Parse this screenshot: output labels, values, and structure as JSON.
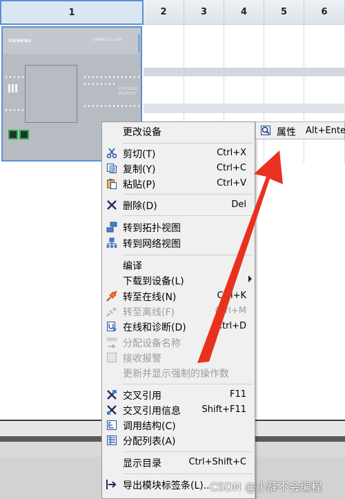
{
  "slots": {
    "headers": [
      "1",
      "2",
      "3",
      "4",
      "5",
      "6"
    ],
    "selected": "1"
  },
  "device": {
    "brand": "SIEMENS",
    "model": "SIMATIC S7-1200",
    "cpu_line1": "CPU 1212C",
    "cpu_line2": "DC/DC/DC"
  },
  "context_menu": {
    "items": [
      {
        "label": "更改设备",
        "shortcut": "",
        "icon": "none",
        "enabled": true
      },
      {
        "label": "剪切(T)",
        "shortcut": "Ctrl+X",
        "icon": "scissors-icon",
        "enabled": true
      },
      {
        "label": "复制(Y)",
        "shortcut": "Ctrl+C",
        "icon": "copy-icon",
        "enabled": true
      },
      {
        "label": "粘贴(P)",
        "shortcut": "Ctrl+V",
        "icon": "paste-icon",
        "enabled": true
      },
      {
        "label": "删除(D)",
        "shortcut": "Del",
        "icon": "delete-icon",
        "enabled": true
      },
      {
        "label": "转到拓扑视图",
        "shortcut": "",
        "icon": "topology-view-icon",
        "enabled": true
      },
      {
        "label": "转到网络视图",
        "shortcut": "",
        "icon": "network-view-icon",
        "enabled": true
      },
      {
        "label": "编译",
        "shortcut": "",
        "icon": "none",
        "enabled": true
      },
      {
        "label": "下载到设备(L)",
        "shortcut": "",
        "icon": "none",
        "enabled": true,
        "submenu": true
      },
      {
        "label": "转至在线(N)",
        "shortcut": "Ctrl+K",
        "icon": "go-online-icon",
        "enabled": true
      },
      {
        "label": "转至离线(F)",
        "shortcut": "Ctrl+M",
        "icon": "go-offline-icon",
        "enabled": false
      },
      {
        "label": "在线和诊断(D)",
        "shortcut": "Ctrl+D",
        "icon": "diagnostics-icon",
        "enabled": true
      },
      {
        "label": "分配设备名称",
        "shortcut": "",
        "icon": "assign-name-icon",
        "enabled": false
      },
      {
        "label": "接收报警",
        "shortcut": "",
        "icon": "receive-alarm-icon",
        "enabled": false
      },
      {
        "label": "更新并显示强制的操作数",
        "shortcut": "",
        "icon": "none",
        "enabled": false
      },
      {
        "label": "交叉引用",
        "shortcut": "F11",
        "icon": "cross-reference-icon",
        "enabled": true
      },
      {
        "label": "交叉引用信息",
        "shortcut": "Shift+F11",
        "icon": "cross-reference-info-icon",
        "enabled": true
      },
      {
        "label": "调用结构(C)",
        "shortcut": "",
        "icon": "call-structure-icon",
        "enabled": true
      },
      {
        "label": "分配列表(A)",
        "shortcut": "",
        "icon": "assignment-list-icon",
        "enabled": true
      },
      {
        "label": "显示目录",
        "shortcut": "Ctrl+Shift+C",
        "icon": "none",
        "enabled": true
      },
      {
        "label": "导出模块标签条(L)...",
        "shortcut": "",
        "icon": "export-icon",
        "enabled": true
      }
    ]
  },
  "submenu": {
    "label": "属性",
    "shortcut": "Alt+Enter",
    "icon": "properties-icon"
  },
  "annotation": {
    "arrow_color": "#e8321f"
  },
  "watermark": "CSDN @小薛不会编程"
}
